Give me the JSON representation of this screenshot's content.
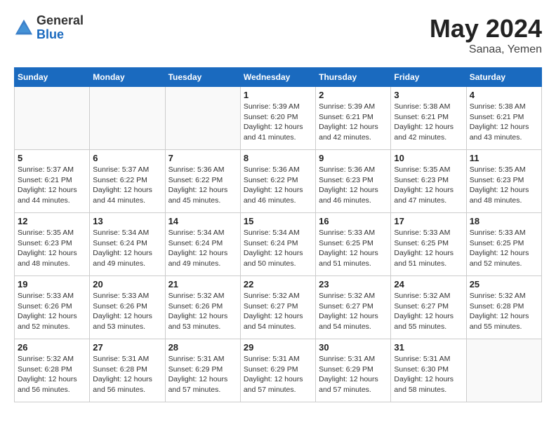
{
  "header": {
    "logo": {
      "general": "General",
      "blue": "Blue"
    },
    "title": "May 2024",
    "location": "Sanaa, Yemen"
  },
  "weekdays": [
    "Sunday",
    "Monday",
    "Tuesday",
    "Wednesday",
    "Thursday",
    "Friday",
    "Saturday"
  ],
  "weeks": [
    [
      {
        "day": "",
        "info": ""
      },
      {
        "day": "",
        "info": ""
      },
      {
        "day": "",
        "info": ""
      },
      {
        "day": "1",
        "info": "Sunrise: 5:39 AM\nSunset: 6:20 PM\nDaylight: 12 hours\nand 41 minutes."
      },
      {
        "day": "2",
        "info": "Sunrise: 5:39 AM\nSunset: 6:21 PM\nDaylight: 12 hours\nand 42 minutes."
      },
      {
        "day": "3",
        "info": "Sunrise: 5:38 AM\nSunset: 6:21 PM\nDaylight: 12 hours\nand 42 minutes."
      },
      {
        "day": "4",
        "info": "Sunrise: 5:38 AM\nSunset: 6:21 PM\nDaylight: 12 hours\nand 43 minutes."
      }
    ],
    [
      {
        "day": "5",
        "info": "Sunrise: 5:37 AM\nSunset: 6:21 PM\nDaylight: 12 hours\nand 44 minutes."
      },
      {
        "day": "6",
        "info": "Sunrise: 5:37 AM\nSunset: 6:22 PM\nDaylight: 12 hours\nand 44 minutes."
      },
      {
        "day": "7",
        "info": "Sunrise: 5:36 AM\nSunset: 6:22 PM\nDaylight: 12 hours\nand 45 minutes."
      },
      {
        "day": "8",
        "info": "Sunrise: 5:36 AM\nSunset: 6:22 PM\nDaylight: 12 hours\nand 46 minutes."
      },
      {
        "day": "9",
        "info": "Sunrise: 5:36 AM\nSunset: 6:23 PM\nDaylight: 12 hours\nand 46 minutes."
      },
      {
        "day": "10",
        "info": "Sunrise: 5:35 AM\nSunset: 6:23 PM\nDaylight: 12 hours\nand 47 minutes."
      },
      {
        "day": "11",
        "info": "Sunrise: 5:35 AM\nSunset: 6:23 PM\nDaylight: 12 hours\nand 48 minutes."
      }
    ],
    [
      {
        "day": "12",
        "info": "Sunrise: 5:35 AM\nSunset: 6:23 PM\nDaylight: 12 hours\nand 48 minutes."
      },
      {
        "day": "13",
        "info": "Sunrise: 5:34 AM\nSunset: 6:24 PM\nDaylight: 12 hours\nand 49 minutes."
      },
      {
        "day": "14",
        "info": "Sunrise: 5:34 AM\nSunset: 6:24 PM\nDaylight: 12 hours\nand 49 minutes."
      },
      {
        "day": "15",
        "info": "Sunrise: 5:34 AM\nSunset: 6:24 PM\nDaylight: 12 hours\nand 50 minutes."
      },
      {
        "day": "16",
        "info": "Sunrise: 5:33 AM\nSunset: 6:25 PM\nDaylight: 12 hours\nand 51 minutes."
      },
      {
        "day": "17",
        "info": "Sunrise: 5:33 AM\nSunset: 6:25 PM\nDaylight: 12 hours\nand 51 minutes."
      },
      {
        "day": "18",
        "info": "Sunrise: 5:33 AM\nSunset: 6:25 PM\nDaylight: 12 hours\nand 52 minutes."
      }
    ],
    [
      {
        "day": "19",
        "info": "Sunrise: 5:33 AM\nSunset: 6:26 PM\nDaylight: 12 hours\nand 52 minutes."
      },
      {
        "day": "20",
        "info": "Sunrise: 5:33 AM\nSunset: 6:26 PM\nDaylight: 12 hours\nand 53 minutes."
      },
      {
        "day": "21",
        "info": "Sunrise: 5:32 AM\nSunset: 6:26 PM\nDaylight: 12 hours\nand 53 minutes."
      },
      {
        "day": "22",
        "info": "Sunrise: 5:32 AM\nSunset: 6:27 PM\nDaylight: 12 hours\nand 54 minutes."
      },
      {
        "day": "23",
        "info": "Sunrise: 5:32 AM\nSunset: 6:27 PM\nDaylight: 12 hours\nand 54 minutes."
      },
      {
        "day": "24",
        "info": "Sunrise: 5:32 AM\nSunset: 6:27 PM\nDaylight: 12 hours\nand 55 minutes."
      },
      {
        "day": "25",
        "info": "Sunrise: 5:32 AM\nSunset: 6:28 PM\nDaylight: 12 hours\nand 55 minutes."
      }
    ],
    [
      {
        "day": "26",
        "info": "Sunrise: 5:32 AM\nSunset: 6:28 PM\nDaylight: 12 hours\nand 56 minutes."
      },
      {
        "day": "27",
        "info": "Sunrise: 5:31 AM\nSunset: 6:28 PM\nDaylight: 12 hours\nand 56 minutes."
      },
      {
        "day": "28",
        "info": "Sunrise: 5:31 AM\nSunset: 6:29 PM\nDaylight: 12 hours\nand 57 minutes."
      },
      {
        "day": "29",
        "info": "Sunrise: 5:31 AM\nSunset: 6:29 PM\nDaylight: 12 hours\nand 57 minutes."
      },
      {
        "day": "30",
        "info": "Sunrise: 5:31 AM\nSunset: 6:29 PM\nDaylight: 12 hours\nand 57 minutes."
      },
      {
        "day": "31",
        "info": "Sunrise: 5:31 AM\nSunset: 6:30 PM\nDaylight: 12 hours\nand 58 minutes."
      },
      {
        "day": "",
        "info": ""
      }
    ]
  ]
}
